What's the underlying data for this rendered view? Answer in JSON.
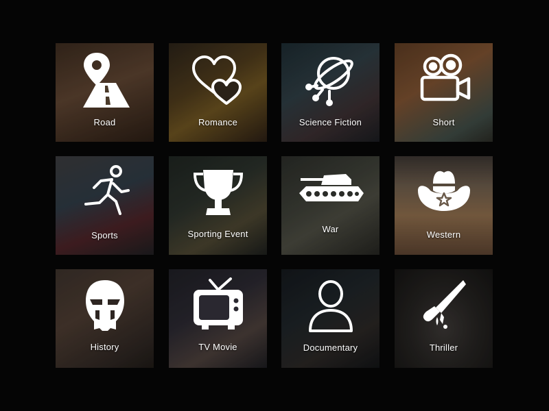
{
  "genres": [
    {
      "label": "Road",
      "icon": "road-map-pin-icon"
    },
    {
      "label": "Romance",
      "icon": "hearts-icon"
    },
    {
      "label": "Science Fiction",
      "icon": "ufo-icon"
    },
    {
      "label": "Short",
      "icon": "movie-camera-icon"
    },
    {
      "label": "Sports",
      "icon": "runner-icon"
    },
    {
      "label": "Sporting Event",
      "icon": "trophy-icon"
    },
    {
      "label": "War",
      "icon": "tank-icon"
    },
    {
      "label": "Western",
      "icon": "cowboy-hat-icon"
    },
    {
      "label": "History",
      "icon": "gladiator-helmet-icon"
    },
    {
      "label": "TV Movie",
      "icon": "television-icon"
    },
    {
      "label": "Documentary",
      "icon": "person-icon"
    },
    {
      "label": "Thriller",
      "icon": "knife-icon"
    }
  ]
}
